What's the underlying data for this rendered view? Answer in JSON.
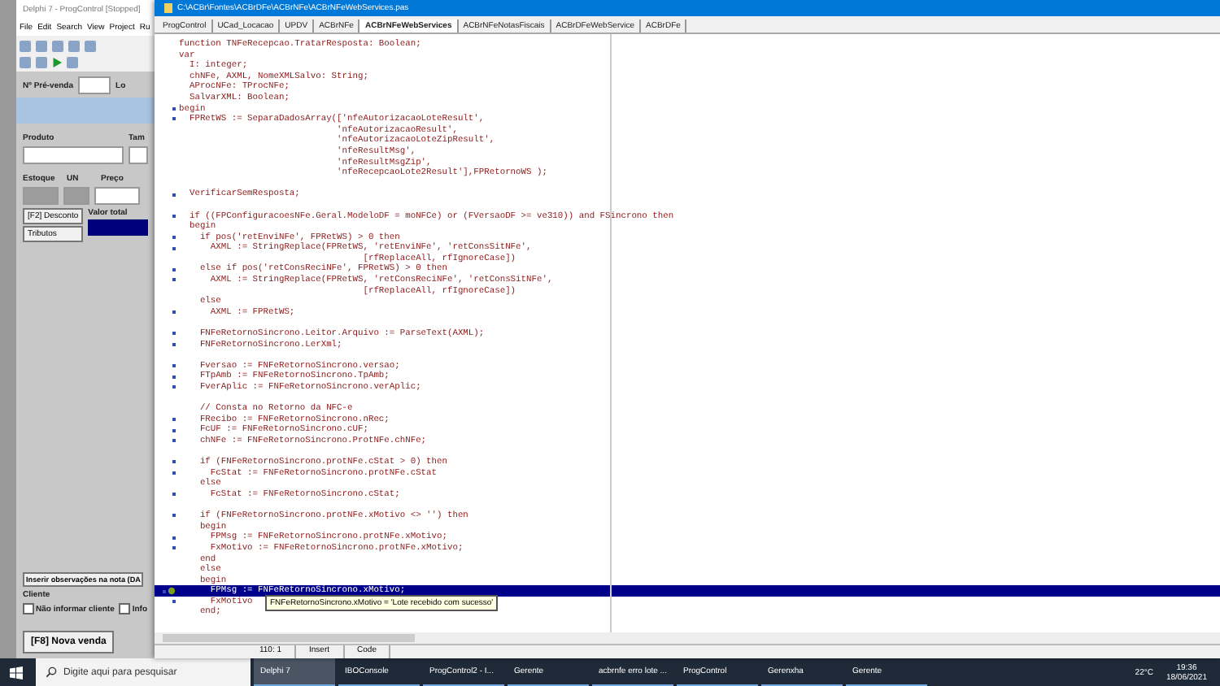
{
  "ide": {
    "title": "Delphi 7 - ProgControl [Stopped]",
    "menu": [
      "File",
      "Edit",
      "Search",
      "View",
      "Project",
      "Ru"
    ]
  },
  "form": {
    "prevenda_label": "Nº Pré-venda",
    "location_label": "Lo",
    "produto_label": "Produto",
    "tam_label": "Tam",
    "estoque_label": "Estoque",
    "un_label": "UN",
    "preco_label": "Preço",
    "desconto_button": "[F2] Desconto",
    "tributos_button": "Tributos",
    "valor_total_label": "Valor total",
    "observacoes_button": "Inserir observações na nota (DA",
    "cliente_label": "Cliente",
    "cliente_options": [
      {
        "label": "Não informar cliente",
        "checked": false
      },
      {
        "label": "Info",
        "checked": false
      }
    ],
    "nova_venda_button": "[F8] Nova venda"
  },
  "editor": {
    "title": "C:\\ACBr\\Fontes\\ACBrDFe\\ACBrNFe\\ACBrNFeWebServices.pas",
    "tabs": [
      {
        "label": "ProgControl",
        "selected": false
      },
      {
        "label": "UCad_Locacao",
        "selected": false
      },
      {
        "label": "UPDV",
        "selected": false
      },
      {
        "label": "ACBrNFe",
        "selected": false
      },
      {
        "label": "ACBrNFeWebServices",
        "selected": true
      },
      {
        "label": "ACBrNFeNotasFiscais",
        "selected": false
      },
      {
        "label": "ACBrDFeWebService",
        "selected": false
      },
      {
        "label": "ACBrDFe",
        "selected": false
      }
    ],
    "lines": [
      {
        "kind": "code",
        "text": "function TNFeRecepcao.TratarResposta: Boolean;",
        "marker": false,
        "selected": false
      },
      {
        "kind": "code",
        "text": "var",
        "marker": false,
        "selected": false
      },
      {
        "kind": "code",
        "text": "  I: integer;",
        "marker": false,
        "selected": false
      },
      {
        "kind": "code",
        "text": "  chNFe, AXML, NomeXMLSalvo: String;",
        "marker": false,
        "selected": false
      },
      {
        "kind": "code",
        "text": "  AProcNFe: TProcNFe;",
        "marker": false,
        "selected": false
      },
      {
        "kind": "code",
        "text": "  SalvarXML: Boolean;",
        "marker": false,
        "selected": false
      },
      {
        "kind": "code",
        "text": "begin",
        "marker": true,
        "selected": false
      },
      {
        "kind": "code",
        "text": "  FPRetWS := SeparaDadosArray(['nfeAutorizacaoLoteResult',",
        "marker": true,
        "selected": false
      },
      {
        "kind": "code",
        "text": "                              'nfeAutorizacaoResult',",
        "marker": false,
        "selected": false
      },
      {
        "kind": "code",
        "text": "                              'nfeAutorizacaoLoteZipResult',",
        "marker": false,
        "selected": false
      },
      {
        "kind": "code",
        "text": "                              'nfeResultMsg',",
        "marker": false,
        "selected": false
      },
      {
        "kind": "code",
        "text": "                              'nfeResultMsgZip',",
        "marker": false,
        "selected": false
      },
      {
        "kind": "code",
        "text": "                              'nfeRecepcaoLote2Result'],FPRetornoWS );",
        "marker": false,
        "selected": false
      },
      {
        "kind": "blank"
      },
      {
        "kind": "code",
        "text": "  VerificarSemResposta;",
        "marker": true,
        "selected": false
      },
      {
        "kind": "blank"
      },
      {
        "kind": "code",
        "text": "  if ((FPConfiguracoesNFe.Geral.ModeloDF = moNFCe) or (FVersaoDF >= ve310)) and FSincrono then",
        "marker": true,
        "selected": false
      },
      {
        "kind": "code",
        "text": "  begin",
        "marker": false,
        "selected": false
      },
      {
        "kind": "code",
        "text": "    if pos('retEnviNFe', FPRetWS) > 0 then",
        "marker": true,
        "selected": false
      },
      {
        "kind": "code",
        "text": "      AXML := StringReplace(FPRetWS, 'retEnviNFe', 'retConsSitNFe',",
        "marker": true,
        "selected": false
      },
      {
        "kind": "code",
        "text": "                                   [rfReplaceAll, rfIgnoreCase])",
        "marker": false,
        "selected": false
      },
      {
        "kind": "code",
        "text": "    else if pos('retConsReciNFe', FPRetWS) > 0 then",
        "marker": true,
        "selected": false
      },
      {
        "kind": "code",
        "text": "      AXML := StringReplace(FPRetWS, 'retConsReciNFe', 'retConsSitNFe',",
        "marker": true,
        "selected": false
      },
      {
        "kind": "code",
        "text": "                                   [rfReplaceAll, rfIgnoreCase])",
        "marker": false,
        "selected": false
      },
      {
        "kind": "code",
        "text": "    else",
        "marker": false,
        "selected": false
      },
      {
        "kind": "code",
        "text": "      AXML := FPRetWS;",
        "marker": true,
        "selected": false
      },
      {
        "kind": "blank"
      },
      {
        "kind": "code",
        "text": "    FNFeRetornoSincrono.Leitor.Arquivo := ParseText(AXML);",
        "marker": true,
        "selected": false
      },
      {
        "kind": "code",
        "text": "    FNFeRetornoSincrono.LerXml;",
        "marker": true,
        "selected": false
      },
      {
        "kind": "blank"
      },
      {
        "kind": "code",
        "text": "    Fversao := FNFeRetornoSincrono.versao;",
        "marker": true,
        "selected": false
      },
      {
        "kind": "code",
        "text": "    FTpAmb := FNFeRetornoSincrono.TpAmb;",
        "marker": true,
        "selected": false
      },
      {
        "kind": "code",
        "text": "    FverAplic := FNFeRetornoSincrono.verAplic;",
        "marker": true,
        "selected": false
      },
      {
        "kind": "blank"
      },
      {
        "kind": "code",
        "text": "    // Consta no Retorno da NFC-e",
        "marker": false,
        "selected": false
      },
      {
        "kind": "code",
        "text": "    FRecibo := FNFeRetornoSincrono.nRec;",
        "marker": true,
        "selected": false
      },
      {
        "kind": "code",
        "text": "    FcUF := FNFeRetornoSincrono.cUF;",
        "marker": true,
        "selected": false
      },
      {
        "kind": "code",
        "text": "    chNFe := FNFeRetornoSincrono.ProtNFe.chNFe;",
        "marker": true,
        "selected": false
      },
      {
        "kind": "blank"
      },
      {
        "kind": "code",
        "text": "    if (FNFeRetornoSincrono.protNFe.cStat > 0) then",
        "marker": true,
        "selected": false
      },
      {
        "kind": "code",
        "text": "      FcStat := FNFeRetornoSincrono.protNFe.cStat",
        "marker": true,
        "selected": false
      },
      {
        "kind": "code",
        "text": "    else",
        "marker": false,
        "selected": false
      },
      {
        "kind": "code",
        "text": "      FcStat := FNFeRetornoSincrono.cStat;",
        "marker": true,
        "selected": false
      },
      {
        "kind": "blank"
      },
      {
        "kind": "code",
        "text": "    if (FNFeRetornoSincrono.protNFe.xMotivo <> '') then",
        "marker": true,
        "selected": false
      },
      {
        "kind": "code",
        "text": "    begin",
        "marker": false,
        "selected": false
      },
      {
        "kind": "code",
        "text": "      FPMsg := FNFeRetornoSincrono.protNFe.xMotivo;",
        "marker": true,
        "selected": false
      },
      {
        "kind": "code",
        "text": "      FxMotivo := FNFeRetornoSincrono.protNFe.xMotivo;",
        "marker": true,
        "selected": false
      },
      {
        "kind": "code",
        "text": "    end",
        "marker": false,
        "selected": false
      },
      {
        "kind": "code",
        "text": "    else",
        "marker": false,
        "selected": false
      },
      {
        "kind": "code",
        "text": "    begin",
        "marker": false,
        "selected": false
      },
      {
        "kind": "code",
        "text": "      FPMsg := FNFeRetornoSincrono.xMotivo;",
        "marker": true,
        "selected": true
      },
      {
        "kind": "code",
        "text": "      FxMotivo",
        "marker": true,
        "selected": false
      },
      {
        "kind": "code",
        "text": "    end;",
        "marker": false,
        "selected": false
      }
    ],
    "tooltip": "FNFeRetornoSincrono.xMotivo = 'Lote recebido com sucesso'",
    "status": [
      "110:  1",
      "Insert",
      "Code"
    ]
  },
  "taskbar": {
    "search_placeholder": "Digite aqui para pesquisar",
    "apps": [
      {
        "label": "Delphi 7",
        "selected": true
      },
      {
        "label": "IBOConsole",
        "selected": false
      },
      {
        "label": "ProgControl2 - I...",
        "selected": false
      },
      {
        "label": "Gerente",
        "selected": false
      },
      {
        "label": "acbrnfe erro lote ...",
        "selected": false
      },
      {
        "label": "ProgControl",
        "selected": false
      },
      {
        "label": "Gerenxha",
        "selected": false
      },
      {
        "label": "Gerente",
        "selected": false
      }
    ],
    "temperature": "22°C",
    "time": "19:36",
    "date": "18/06/2021"
  }
}
